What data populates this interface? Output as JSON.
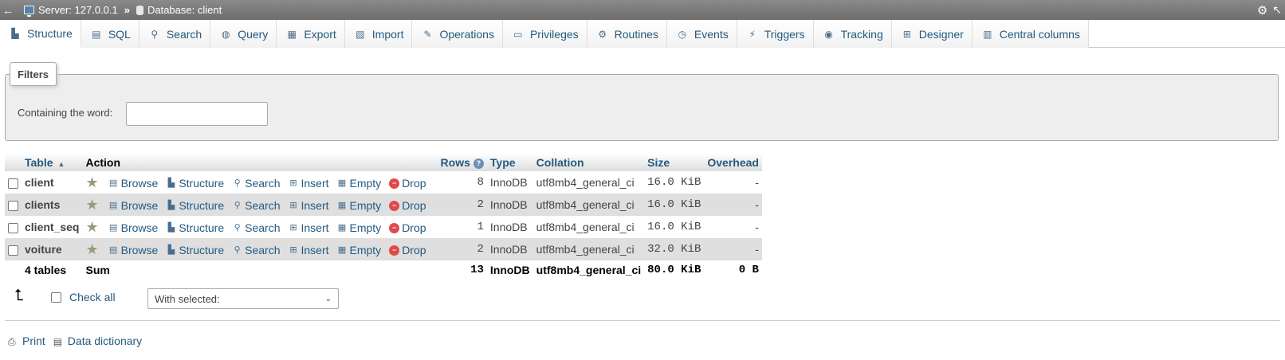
{
  "topbar": {
    "server_label": "Server: 127.0.0.1",
    "separator": "»",
    "database_label": "Database: client"
  },
  "tabs": [
    {
      "label": "Structure",
      "icon": "structure-icon",
      "glyph": "▙"
    },
    {
      "label": "SQL",
      "icon": "sql-icon",
      "glyph": "▤"
    },
    {
      "label": "Search",
      "icon": "search-icon",
      "glyph": "⚲"
    },
    {
      "label": "Query",
      "icon": "query-icon",
      "glyph": "◍"
    },
    {
      "label": "Export",
      "icon": "export-icon",
      "glyph": "▦"
    },
    {
      "label": "Import",
      "icon": "import-icon",
      "glyph": "▧"
    },
    {
      "label": "Operations",
      "icon": "wrench-icon",
      "glyph": "✎"
    },
    {
      "label": "Privileges",
      "icon": "privileges-icon",
      "glyph": "▭"
    },
    {
      "label": "Routines",
      "icon": "routines-icon",
      "glyph": "⚙"
    },
    {
      "label": "Events",
      "icon": "clock-icon",
      "glyph": "◷"
    },
    {
      "label": "Triggers",
      "icon": "triggers-icon",
      "glyph": "⚡"
    },
    {
      "label": "Tracking",
      "icon": "eye-icon",
      "glyph": "◉"
    },
    {
      "label": "Designer",
      "icon": "designer-icon",
      "glyph": "⊞"
    },
    {
      "label": "Central columns",
      "icon": "central-columns-icon",
      "glyph": "▥"
    }
  ],
  "filters": {
    "legend": "Filters",
    "label": "Containing the word:",
    "value": "",
    "placeholder": ""
  },
  "table": {
    "headers": {
      "table": "Table",
      "action": "Action",
      "rows": "Rows",
      "type": "Type",
      "collation": "Collation",
      "size": "Size",
      "overhead": "Overhead"
    },
    "actions": {
      "browse": "Browse",
      "structure": "Structure",
      "search": "Search",
      "insert": "Insert",
      "empty": "Empty",
      "drop": "Drop"
    },
    "rows": [
      {
        "name": "client",
        "rows": "8",
        "type": "InnoDB",
        "collation": "utf8mb4_general_ci",
        "size": "16.0 KiB",
        "overhead": "-"
      },
      {
        "name": "clients",
        "rows": "2",
        "type": "InnoDB",
        "collation": "utf8mb4_general_ci",
        "size": "16.0 KiB",
        "overhead": "-"
      },
      {
        "name": "client_seq",
        "rows": "1",
        "type": "InnoDB",
        "collation": "utf8mb4_general_ci",
        "size": "16.0 KiB",
        "overhead": "-"
      },
      {
        "name": "voiture",
        "rows": "2",
        "type": "InnoDB",
        "collation": "utf8mb4_general_ci",
        "size": "32.0 KiB",
        "overhead": "-"
      }
    ],
    "footer": {
      "count": "4 tables",
      "sum": "Sum",
      "rows": "13",
      "type": "InnoDB",
      "collation": "utf8mb4_general_ci",
      "size": "80.0 KiB",
      "overhead": "0 B"
    }
  },
  "bulk": {
    "check_all": "Check all",
    "with_selected": "With selected:"
  },
  "footer_links": {
    "print": "Print",
    "data_dictionary": "Data dictionary"
  },
  "colors": {
    "link": "#235a81",
    "topbar": "#7a7a7a",
    "row_alt": "#dfdfdf"
  }
}
